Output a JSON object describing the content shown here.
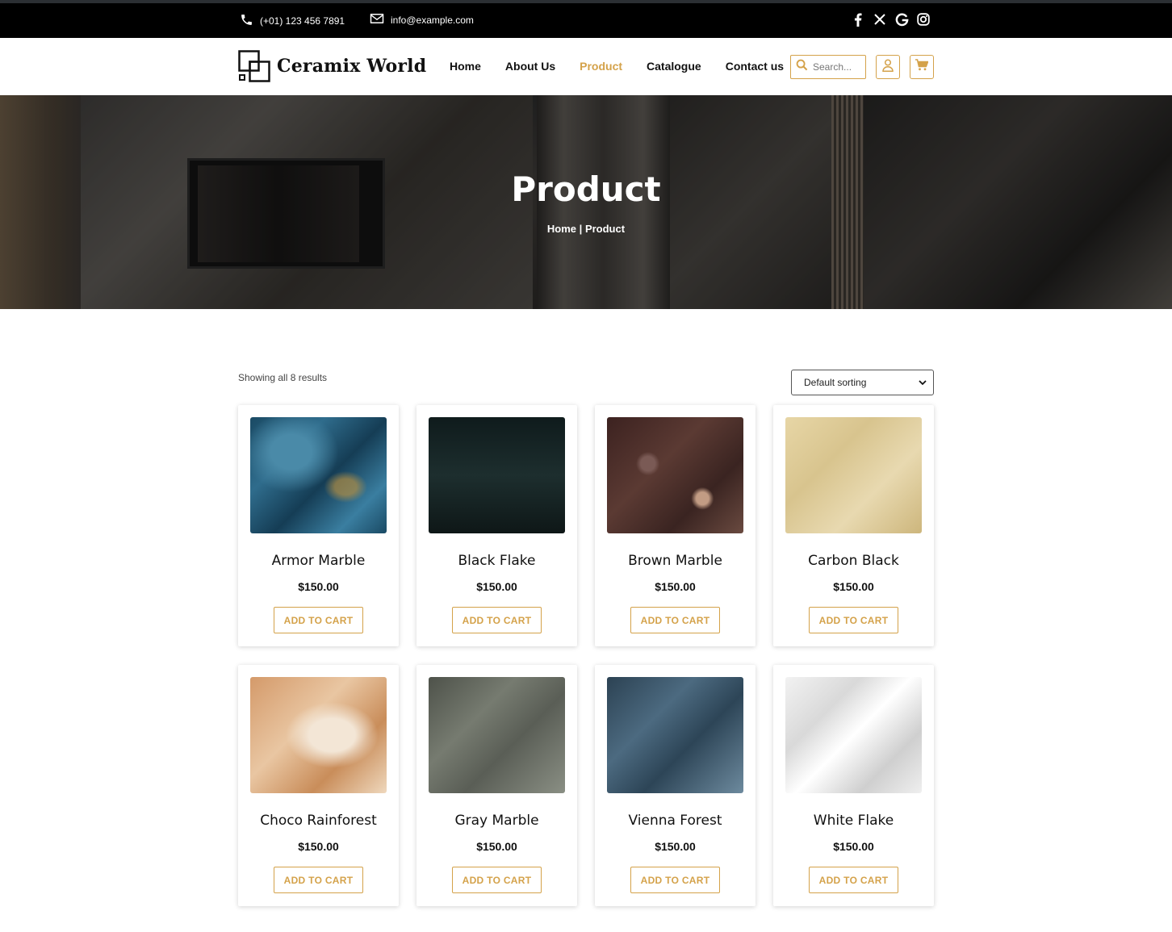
{
  "topbar": {
    "phone": "(+01) 123 456 7891",
    "email": "info@example.com",
    "social_icons": [
      "facebook-icon",
      "x-icon",
      "google-icon",
      "instagram-icon"
    ]
  },
  "header": {
    "logo_text": "Ceramix World",
    "nav": [
      {
        "label": "Home",
        "active": false
      },
      {
        "label": "About Us",
        "active": false
      },
      {
        "label": "Product",
        "active": true
      },
      {
        "label": "Catalogue",
        "active": false
      },
      {
        "label": "Contact us",
        "active": false
      }
    ],
    "search_placeholder": "Search...",
    "accent_color": "#d4a24a"
  },
  "hero": {
    "title": "Product",
    "breadcrumb_home": "Home",
    "breadcrumb_separator": "|",
    "breadcrumb_current": "Product"
  },
  "shop": {
    "result_count": "Showing all 8 results",
    "sort_selected": "Default sorting"
  },
  "products": [
    {
      "name": "Armor Marble",
      "price": "$150.00",
      "button": "ADD TO CART"
    },
    {
      "name": "Black Flake",
      "price": "$150.00",
      "button": "ADD TO CART"
    },
    {
      "name": "Brown Marble",
      "price": "$150.00",
      "button": "ADD TO CART"
    },
    {
      "name": "Carbon Black",
      "price": "$150.00",
      "button": "ADD TO CART"
    },
    {
      "name": "Choco Rainforest",
      "price": "$150.00",
      "button": "ADD TO CART"
    },
    {
      "name": "Gray Marble",
      "price": "$150.00",
      "button": "ADD TO CART"
    },
    {
      "name": "Vienna Forest",
      "price": "$150.00",
      "button": "ADD TO CART"
    },
    {
      "name": "White Flake",
      "price": "$150.00",
      "button": "ADD TO CART"
    }
  ]
}
